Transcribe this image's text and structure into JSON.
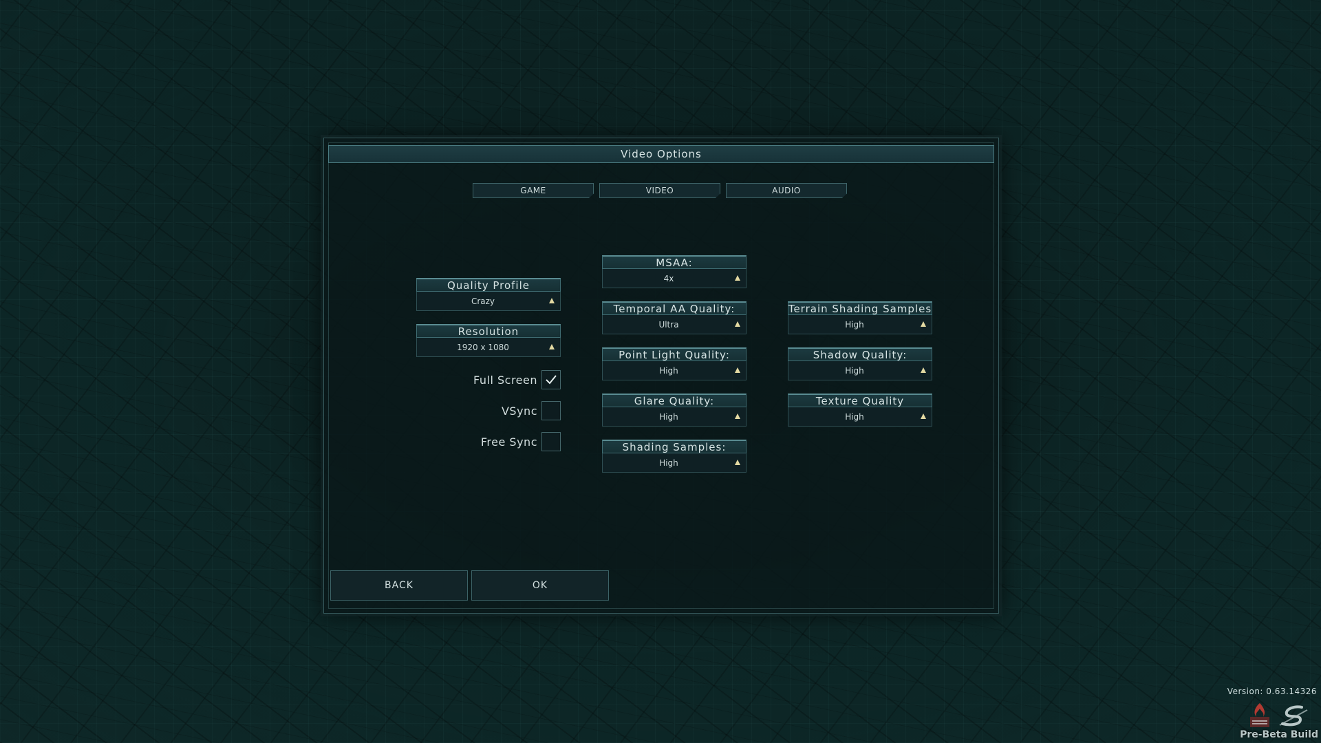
{
  "window": {
    "title": "Video Options"
  },
  "tabs": [
    {
      "label": "GAME"
    },
    {
      "label": "VIDEO"
    },
    {
      "label": "AUDIO"
    }
  ],
  "settings": {
    "quality_profile": {
      "label": "Quality Profile",
      "value": "Crazy"
    },
    "resolution": {
      "label": "Resolution",
      "value": "1920 x 1080"
    },
    "msaa": {
      "label": "MSAA:",
      "value": "4x"
    },
    "temporal_aa": {
      "label": "Temporal AA Quality:",
      "value": "Ultra"
    },
    "point_light": {
      "label": "Point Light Quality:",
      "value": "High"
    },
    "glare": {
      "label": "Glare Quality:",
      "value": "High"
    },
    "shading_samples": {
      "label": "Shading Samples:",
      "value": "High"
    },
    "terrain_shading": {
      "label": "Terrain Shading Samples",
      "value": "High"
    },
    "shadow": {
      "label": "Shadow Quality:",
      "value": "High"
    },
    "texture": {
      "label": "Texture Quality",
      "value": "High"
    }
  },
  "toggles": {
    "full_screen": {
      "label": "Full Screen",
      "checked": true
    },
    "vsync": {
      "label": "VSync",
      "checked": false
    },
    "free_sync": {
      "label": "Free Sync",
      "checked": false
    }
  },
  "buttons": {
    "back": "BACK",
    "ok": "OK"
  },
  "footer": {
    "version": "Version: 0.63.14326",
    "build": "Pre-Beta Build"
  },
  "colors": {
    "accent_arrow": "#e3d9a2",
    "panel_border": "#4a7a80"
  }
}
